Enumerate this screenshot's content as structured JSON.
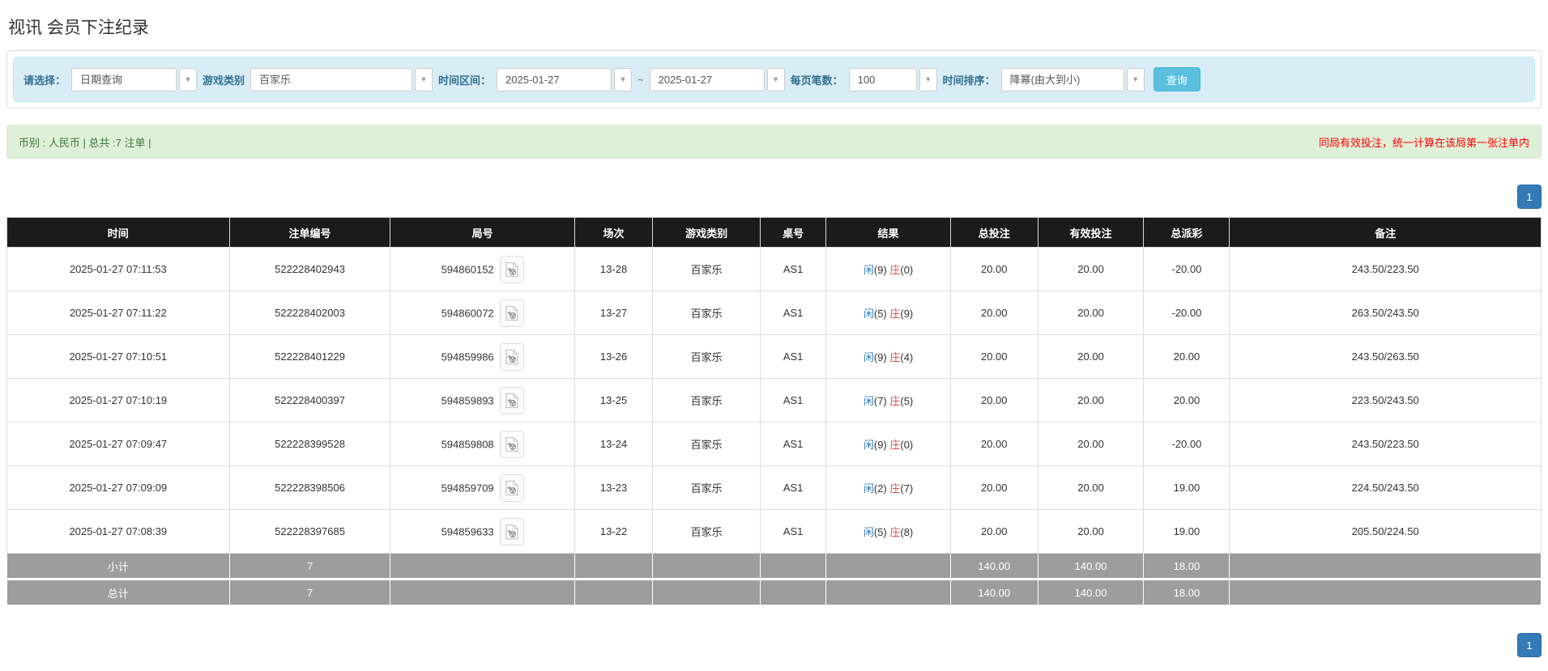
{
  "page": {
    "title": "视讯 会员下注纪录"
  },
  "filters": {
    "select_label": "请选择：",
    "select_value": "日期查询",
    "game_label": "游戏类别",
    "game_value": "百家乐",
    "range_label": "时间区间：",
    "date_from": "2025-01-27",
    "tilde": "~",
    "date_to": "2025-01-27",
    "per_page_label": "每页笔数：",
    "per_page_value": "100",
    "sort_label": "时间排序：",
    "sort_value": "降幂(由大到小)",
    "query_button": "查询",
    "caret": "▼"
  },
  "summary": {
    "left": "币别 : 人民币 | 总共 :7 注单 |",
    "right": "同局有效投注，统一计算在该局第一张注单内"
  },
  "pagination": {
    "page": "1"
  },
  "table": {
    "headers": [
      "时间",
      "注单编号",
      "局号",
      "场次",
      "游戏类别",
      "桌号",
      "结果",
      "总投注",
      "有效投注",
      "总派彩",
      "备注"
    ],
    "rows": [
      {
        "time": "2025-01-27 07:11:53",
        "bet_id": "522228402943",
        "round_id": "594860152",
        "session": "13-28",
        "game": "百家乐",
        "table_no": "AS1",
        "player_label": "闲",
        "player_score": "(9)",
        "banker_label": "庄",
        "banker_score": "(0)",
        "total_bet": "20.00",
        "valid_bet": "20.00",
        "payout": "-20.00",
        "remark": "243.50/223.50"
      },
      {
        "time": "2025-01-27 07:11:22",
        "bet_id": "522228402003",
        "round_id": "594860072",
        "session": "13-27",
        "game": "百家乐",
        "table_no": "AS1",
        "player_label": "闲",
        "player_score": "(5)",
        "banker_label": "庄",
        "banker_score": "(9)",
        "total_bet": "20.00",
        "valid_bet": "20.00",
        "payout": "-20.00",
        "remark": "263.50/243.50"
      },
      {
        "time": "2025-01-27 07:10:51",
        "bet_id": "522228401229",
        "round_id": "594859986",
        "session": "13-26",
        "game": "百家乐",
        "table_no": "AS1",
        "player_label": "闲",
        "player_score": "(9)",
        "banker_label": "庄",
        "banker_score": "(4)",
        "total_bet": "20.00",
        "valid_bet": "20.00",
        "payout": "20.00",
        "remark": "243.50/263.50"
      },
      {
        "time": "2025-01-27 07:10:19",
        "bet_id": "522228400397",
        "round_id": "594859893",
        "session": "13-25",
        "game": "百家乐",
        "table_no": "AS1",
        "player_label": "闲",
        "player_score": "(7)",
        "banker_label": "庄",
        "banker_score": "(5)",
        "total_bet": "20.00",
        "valid_bet": "20.00",
        "payout": "20.00",
        "remark": "223.50/243.50"
      },
      {
        "time": "2025-01-27 07:09:47",
        "bet_id": "522228399528",
        "round_id": "594859808",
        "session": "13-24",
        "game": "百家乐",
        "table_no": "AS1",
        "player_label": "闲",
        "player_score": "(9)",
        "banker_label": "庄",
        "banker_score": "(0)",
        "total_bet": "20.00",
        "valid_bet": "20.00",
        "payout": "-20.00",
        "remark": "243.50/223.50"
      },
      {
        "time": "2025-01-27 07:09:09",
        "bet_id": "522228398506",
        "round_id": "594859709",
        "session": "13-23",
        "game": "百家乐",
        "table_no": "AS1",
        "player_label": "闲",
        "player_score": "(2)",
        "banker_label": "庄",
        "banker_score": "(7)",
        "total_bet": "20.00",
        "valid_bet": "20.00",
        "payout": "19.00",
        "remark": "224.50/243.50"
      },
      {
        "time": "2025-01-27 07:08:39",
        "bet_id": "522228397685",
        "round_id": "594859633",
        "session": "13-22",
        "game": "百家乐",
        "table_no": "AS1",
        "player_label": "闲",
        "player_score": "(5)",
        "banker_label": "庄",
        "banker_score": "(8)",
        "total_bet": "20.00",
        "valid_bet": "20.00",
        "payout": "19.00",
        "remark": "205.50/224.50"
      }
    ],
    "footer": [
      {
        "label": "小计",
        "count": "7",
        "total_bet": "140.00",
        "valid_bet": "140.00",
        "payout": "18.00"
      },
      {
        "label": "总计",
        "count": "7",
        "total_bet": "140.00",
        "valid_bet": "140.00",
        "payout": "18.00"
      }
    ]
  },
  "colors": {
    "filter_bar_bg": "#d9edf7",
    "filter_label": "#31708f",
    "query_button_bg": "#5bc0de",
    "summary_bg": "#dff0d8",
    "summary_text_green": "#3c763d",
    "summary_text_red": "#ff0000",
    "table_header_bg": "#1b1b1b",
    "table_footer_bg": "#9d9d9d",
    "link_blue": "#337ab7",
    "player_blue": "#337ab7",
    "banker_red": "#d9534f",
    "negative_red": "#ff0000",
    "pagination_bg": "#337ab7"
  }
}
